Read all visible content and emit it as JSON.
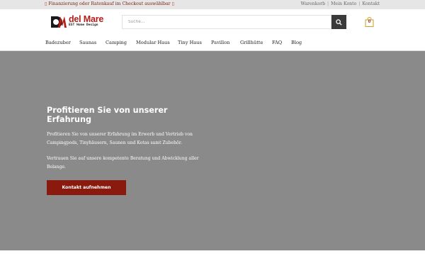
{
  "topbar": {
    "promo_text": "Finanzierung oder Ratenkauf im Checkout auswählbar",
    "promo_icon": "box-glyph",
    "links": [
      "Warenkorb",
      "Mein Konto",
      "Kontakt"
    ],
    "separator": "|"
  },
  "header": {
    "logo_text": "del Mare",
    "logo_sub": "EST Home Design",
    "search_placeholder": "Suche...",
    "search_icon": "search-icon",
    "cart_count": "0",
    "cart_icon": "shopping-bag-icon"
  },
  "nav": {
    "items": [
      "Badezuber",
      "Saunas",
      "Camping",
      "Modular Haus",
      "Tiny Haus",
      "Pavillon",
      "Grillhütte",
      "FAQ",
      "Blog"
    ]
  },
  "hero": {
    "title": "Profitieren Sie von unserer Erfahrung",
    "paragraph1": "Profitieren Sie von unserer Erfahrung im Erwerb und Vertrieb von Campingpods, Tinyhäusern, Saunen und Kotas samt Zubehör.",
    "paragraph2": "Vertrauen Sie auf unsere kompetente Beratung und Abwicklung aller Belange.",
    "button_label": "Kontakt aufnehmen"
  },
  "colors": {
    "brand_red": "#b01e17",
    "button_red": "#8b1a0e",
    "hero_bg": "#8a8a8a",
    "topbar_bg": "#e6e6e6"
  }
}
